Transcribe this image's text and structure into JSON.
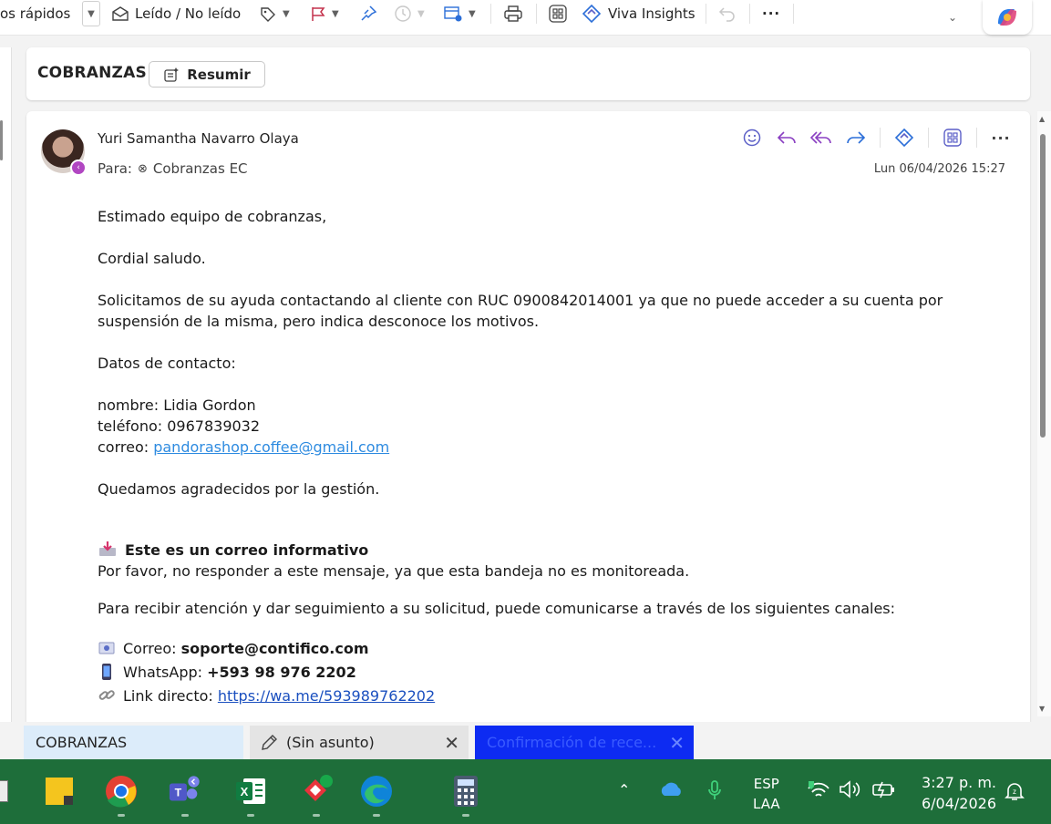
{
  "toolbar": {
    "quick_steps_label": "os rápidos",
    "read_unread_label": "Leído / No leído",
    "viva_insights_label": "Viva Insights",
    "more_label": "···"
  },
  "subject_bar": {
    "subject": "COBRANZAS",
    "summarize_label": "Resumir"
  },
  "message": {
    "sender": "Yuri Samantha Navarro Olaya",
    "to_label": "Para:",
    "recipient": "Cobranzas EC",
    "date": "Lun 06/04/2026 15:27",
    "body": {
      "greeting": "Estimado equipo de cobranzas,",
      "salutation": "Cordial saludo.",
      "request_line1": "Solicitamos de su ayuda contactando al cliente con RUC 0900842014001 ya que no puede acceder a su cuenta por",
      "request_line2": "suspensión de la misma, pero indica desconoce los motivos.",
      "contact_heading": "Datos de contacto:",
      "name_line": "nombre: Lidia Gordon",
      "phone_line": "teléfono: 0967839032",
      "email_label": "correo: ",
      "email_link": "pandorashop.coffee@gmail.com",
      "thanks": "Quedamos agradecidos por la gestión.",
      "info_title": "Este es un correo informativo",
      "info_note": "Por favor, no responder a este mensaje, ya que esta bandeja no es monitoreada.",
      "channels_intro": "Para recibir atención y dar seguimiento a su solicitud, puede comunicarse a través de los siguientes canales:",
      "support_label": "Correo: ",
      "support_email": "soporte@contifico.com",
      "whatsapp_label": "WhatsApp: ",
      "whatsapp_number": "+593 98 976 2202",
      "direct_link_label": "Link directo: ",
      "direct_link": "https://wa.me/593989762202"
    }
  },
  "tabs": [
    {
      "label": "COBRANZAS"
    },
    {
      "label": "(Sin asunto)"
    },
    {
      "label": "Confirmación de rece..."
    }
  ],
  "tray": {
    "language_line1": "ESP",
    "language_line2": "LAA",
    "time": "3:27 p. m.",
    "date": "6/04/2026"
  },
  "colors": {
    "accent": "#5b5fc7",
    "link": "#2e8be0",
    "active_tab": "#0d2bf2",
    "taskbar": "#1e6e3a"
  }
}
